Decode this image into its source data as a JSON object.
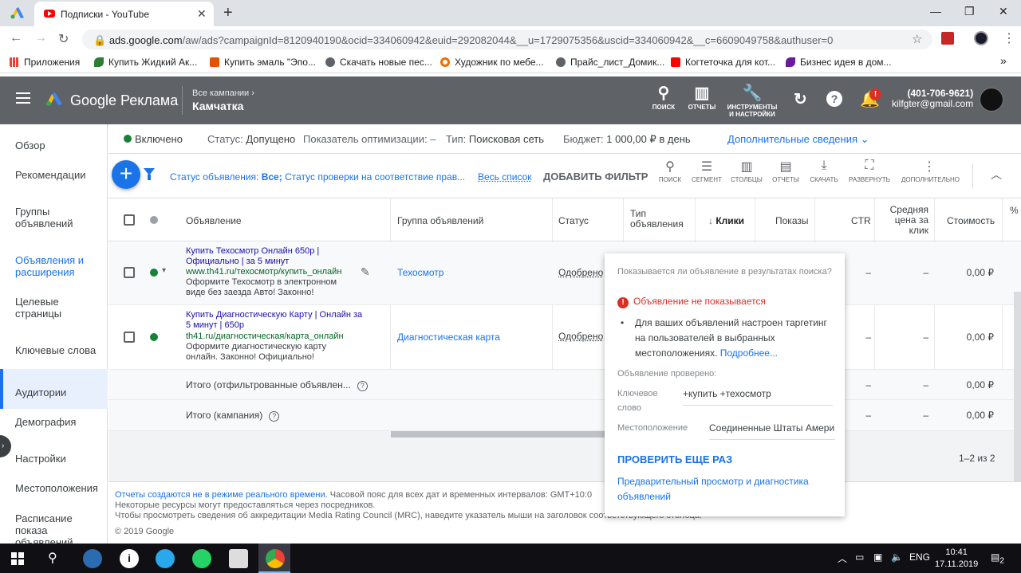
{
  "browser": {
    "tab_title": "Подписки - YouTube",
    "tab_close": "✕",
    "new_tab": "+",
    "url_host": "ads.google.com",
    "url_rest": "/aw/ads?campaignId=8120940190&ocid=334060942&euid=292082044&__u=1729075356&uscid=334060942&__c=6609049758&authuser=0",
    "window_minimize": "—",
    "window_restore": "❐",
    "window_close": "✕",
    "bookmarks": [
      {
        "label": "Приложения",
        "icon": "apps-icon",
        "color": "#5f6368"
      },
      {
        "label": "Купить Жидкий Ак...",
        "icon": "leaf-icon",
        "color": "#2e7d32"
      },
      {
        "label": "Купить эмаль \"Эпо...",
        "icon": "e-icon",
        "color": "#e65100"
      },
      {
        "label": "Скачать новые пес...",
        "icon": "globe-icon",
        "color": "#5f6368"
      },
      {
        "label": "Художник по мебе...",
        "icon": "ring-icon",
        "color": "#ef6c00"
      },
      {
        "label": "Прайс_лист_Домик...",
        "icon": "globe-icon",
        "color": "#5f6368"
      },
      {
        "label": "Когтеточка для кот...",
        "icon": "youtube-icon",
        "color": "#ff0000"
      },
      {
        "label": "Бизнес идея в дом...",
        "icon": "pen-icon",
        "color": "#6a1b9a"
      }
    ],
    "bookmarks_more": "»"
  },
  "header": {
    "brand": "Google Реклама",
    "all_campaigns": "Все кампании",
    "campaign": "Камчатка",
    "tools": [
      {
        "label": "ПОИСК",
        "icon": "search-icon",
        "glyph": "⚲"
      },
      {
        "label": "ОТЧЕТЫ",
        "icon": "reports-icon",
        "glyph": "▥"
      },
      {
        "label": "ИНСТРУМЕНТЫ И НАСТРОЙКИ",
        "icon": "wrench-icon",
        "glyph": "🔧"
      }
    ],
    "notifications_badge": "!",
    "phone": "(401-706-9621)",
    "email": "kilfgter@gmail.com"
  },
  "sidebar": {
    "items": [
      {
        "label": "Обзор"
      },
      {
        "label": "Рекомендации"
      },
      {
        "label": "Группы объявлений"
      },
      {
        "label": "Объявления и расширения",
        "active": true
      },
      {
        "label": "Целевые страницы"
      },
      {
        "label": "Ключевые слова"
      },
      {
        "label": "Аудитории"
      },
      {
        "label": "Демография"
      },
      {
        "label": "Настройки"
      },
      {
        "label": "Местоположения"
      },
      {
        "label": "Расписание показа объявлений"
      }
    ]
  },
  "statusbar": {
    "enabled": "Включено",
    "status_label": "Статус:",
    "status_value": "Допущено",
    "opt_label": "Показатель оптимизации:",
    "opt_value": "–",
    "type_label": "Тип:",
    "type_value": "Поисковая сеть",
    "budget_label": "Бюджет:",
    "budget_value": "1 000,00 ₽ в день",
    "more_info": "Дополнительные сведения"
  },
  "filterbar": {
    "filter_prefix": "Статус объявления:",
    "filter_bold": "Все;",
    "filter_rest": "Статус проверки на соответствие прав...",
    "all_list": "Весь список",
    "add_filter": "ДОБАВИТЬ ФИЛЬТР",
    "tools": [
      {
        "label": "ПОИСК",
        "icon": "search-icon",
        "glyph": "⚲"
      },
      {
        "label": "СЕГМЕНТ",
        "icon": "segment-icon",
        "glyph": "☰"
      },
      {
        "label": "СТОЛБЦЫ",
        "icon": "columns-icon",
        "glyph": "▥"
      },
      {
        "label": "ОТЧЕТЫ",
        "icon": "reports-icon",
        "glyph": "▤"
      },
      {
        "label": "СКАЧАТЬ",
        "icon": "download-icon",
        "glyph": "⤓"
      },
      {
        "label": "РАЗВЕРНУТЬ",
        "icon": "expand-icon",
        "glyph": "⛶"
      },
      {
        "label": "ДОПОЛНИТЕЛЬНО",
        "icon": "more-icon",
        "glyph": "⋮"
      }
    ]
  },
  "table": {
    "headers": {
      "ad": "Объявление",
      "group": "Группа объявлений",
      "status": "Статус",
      "type": "Тип объявления",
      "clicks": "Клики",
      "impressions": "Показы",
      "ctr": "CTR",
      "avg_price": "Средняя цена за клик",
      "cost": "Стоимость",
      "pct": "%"
    },
    "rows": [
      {
        "title": "Купить Техосмотр Онлайн 650р | Официально | за 5 минут",
        "url": "www.th41.ru/техосмотр/купить_онлайн",
        "desc": "Оформите Техосмотр в электронном виде без заезда Авто! Законно!",
        "group": "Техосмотр",
        "status": "Одобрено",
        "ctr": "–",
        "avg": "–",
        "cost": "0,00 ₽"
      },
      {
        "title": "Купить Диагностическую Карту | Онлайн за 5 минут | 650р",
        "url": "th41.ru/диагностическая/карта_онлайн",
        "desc": "Оформите диагностическую карту онлайн. Законно! Официально!",
        "group": "Диагностическая карта",
        "status": "Одобрено",
        "ctr": "–",
        "avg": "–",
        "cost": "0,00 ₽"
      }
    ],
    "totals": [
      {
        "label": "Итого (отфильтрованные объявлен...",
        "ctr": "–",
        "avg": "–",
        "cost": "0,00 ₽"
      },
      {
        "label": "Итого (кампания)",
        "ctr": "–",
        "avg": "–",
        "cost": "0,00 ₽"
      }
    ],
    "paging": "1–2 из 2"
  },
  "footer": {
    "line1_link": "Отчеты создаются не в режиме реального времени.",
    "line1_rest": " Часовой пояс для всех дат и временных интервалов: GMT+10:0",
    "line2": "Некоторые ресурсы могут предоставляться через посредников.",
    "line3": "Чтобы просмотреть сведения об аккредитации Media Rating Council (MRC), наведите указатель мыши на заголовок соответствующего столбца.",
    "copyright": "© 2019 Google"
  },
  "popup": {
    "question": "Показывается ли объявление в результатах поиска?",
    "error": "Объявление не показывается",
    "reason": "Для ваших объявлений настроен таргетинг на пользователей в выбранных местоположениях.",
    "more_link": "Подробнее...",
    "checked": "Объявление проверено:",
    "keyword_label": "Ключевое слово",
    "keyword_value": "+купить +техосмотр",
    "location_label": "Местоположение",
    "location_value": "Соединенные Штаты Амери",
    "recheck": "ПРОВЕРИТЬ ЕЩЕ РАЗ",
    "preview": "Предварительный просмотр и диагностика объявлений"
  },
  "taskbar": {
    "lang": "ENG",
    "time": "10:41",
    "date": "17.11.2019",
    "notif_count": "2"
  }
}
